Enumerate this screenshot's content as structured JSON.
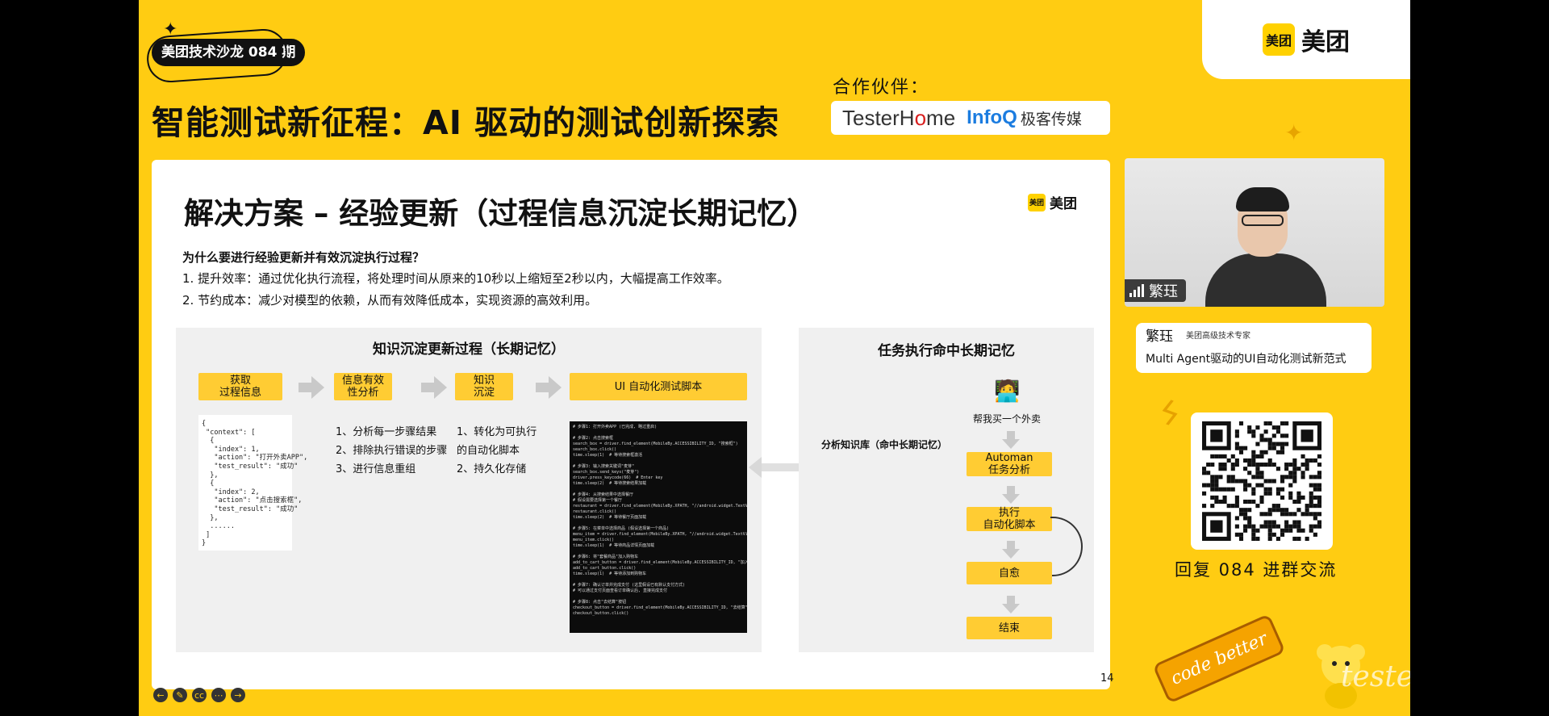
{
  "header": {
    "salon_badge": "美团技术沙龙 084 期",
    "main_title": "智能测试新征程：AI 驱动的测试创新探索",
    "partners_label": "合作伙伴：",
    "partners": {
      "testerhome_a": "TesterH",
      "testerhome_o": "o",
      "testerhome_b": "me",
      "infoq": "InfoQ",
      "geek": "极客传媒"
    },
    "brand_square": "美团",
    "brand_word": "美团"
  },
  "slide": {
    "title": "解决方案 – 经验更新（过程信息沉淀长期记忆）",
    "logo_square": "美团",
    "logo_word": "美团",
    "question": "为什么要进行经验更新并有效沉淀执行过程？",
    "reasons": [
      "1. 提升效率：通过优化执行流程，将处理时间从原来的10秒以上缩短至2秒以内，大幅提高工作效率。",
      "2. 节约成本：减少对模型的依赖，从而有效降低成本，实现资源的高效利用。"
    ],
    "left_panel": {
      "title": "知识沉淀更新过程（长期记忆）",
      "steps": [
        "获取\n过程信息",
        "信息有效\n性分析",
        "知识\n沉淀",
        "UI 自动化测试脚本"
      ],
      "json_sample": "{\n \"context\": [\n  {\n   \"index\": 1,\n   \"action\": \"打开外卖APP\",\n   \"test_result\": \"成功\"\n  },\n  {\n   \"index\": 2,\n   \"action\": \"点击搜索框\",\n   \"test_result\": \"成功\"\n  },\n  ......\n ]\n}",
      "analyze_list": [
        "1、分析每一步骤结果",
        "2、排除执行错误的步骤",
        "3、进行信息重组"
      ],
      "store_list": [
        "1、转化为可执行",
        "的自动化脚本",
        "2、持久化存储"
      ],
      "code_lines": [
        "# 步骤1: 打开外卖APP (已完成, 略过重启)",
        "",
        "# 步骤2: 点击搜索框",
        "search_box = driver.find_element(MobileBy.ACCESSIBILITY_ID, \"搜索框\")",
        "search_box.click()",
        "time.sleep(1)  # 等待搜索框激活",
        "",
        "# 步骤3: 输入搜索关键词\"麦芽\"",
        "search_box.send_keys(\"麦芽\")",
        "driver.press_keycode(66)  # Enter key",
        "time.sleep(2)  # 等待搜索结果加载",
        "",
        "# 步骤4: 从搜索结果中选择餐厅",
        "# 假设需要选择第一个餐厅",
        "restaurant = driver.find_element(MobileBy.XPATH, \"//android.widget.TextView[@text='麦当劳']\")",
        "restaurant.click()",
        "time.sleep(2)  # 等待餐厅页面加载",
        "",
        "# 步骤5: 在菜单中选择商品 (假设选择第一个商品)",
        "menu_item = driver.find_element(MobileBy.XPATH, \"//android.widget.TextView[@text='套餐']\")",
        "menu_item.click()",
        "time.sleep(1)  # 等待商品详情页面加载",
        "",
        "# 步骤6: 将\"套餐商品\"加入购物车",
        "add_to_cart_button = driver.find_element(MobileBy.ACCESSIBILITY_ID, \"加入购物车\")",
        "add_to_cart_button.click()",
        "time.sleep(1)  # 等待添加到购物车",
        "",
        "# 步骤7: 确认订单并完成支付 (这里假设已有默认支付方式)",
        "# 可以通过支付页面查看订单确认后, 直接完成支付",
        "",
        "# 步骤8: 点击\"去结算\"按钮",
        "checkout_button = driver.find_element(MobileBy.ACCESSIBILITY_ID, \"去结算\")",
        "checkout_button.click()"
      ]
    },
    "right_panel": {
      "title": "任务执行命中长期记忆",
      "request": "帮我买一个外卖",
      "knowledge_label": "分析知识库（命中长期记忆）",
      "flow": [
        "Automan\n任务分析",
        "执行\n自动化脚本",
        "自愈",
        "结束"
      ]
    },
    "page_number": "14"
  },
  "toolbar": {
    "buttons": [
      {
        "icon": "back-arrow-icon",
        "glyph": "←"
      },
      {
        "icon": "pen-icon",
        "glyph": "✎"
      },
      {
        "icon": "captions-icon",
        "glyph": "cc"
      },
      {
        "icon": "more-icon",
        "glyph": "⋯"
      },
      {
        "icon": "forward-arrow-icon",
        "glyph": "→"
      }
    ]
  },
  "video": {
    "name_tag": "繁珏"
  },
  "speaker": {
    "name": "繁珏",
    "role": "美团高级技术专家",
    "topic": "Multi Agent驱动的UI自动化测试新范式"
  },
  "qr": {
    "caption": "回复 084 进群交流"
  },
  "stamp": "code better",
  "watermark": "testerhome.com",
  "colors": {
    "accent_yellow": "#ffcc12",
    "box_yellow": "#ffcc33",
    "panel_gray": "#f0f0f0"
  }
}
